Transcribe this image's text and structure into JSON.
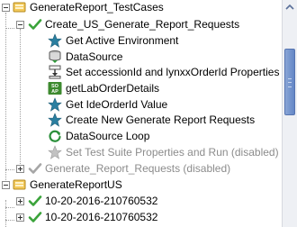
{
  "tree": {
    "suite": {
      "label": "GenerateReport_TestCases",
      "case_expanded": {
        "label": "Create_US_Generate_Report_Requests",
        "steps": [
          {
            "label": "Get Active Environment",
            "icon": "star-icon",
            "disabled": false
          },
          {
            "label": "DataSource",
            "icon": "datasource-icon",
            "disabled": false
          },
          {
            "label": "Set accessionId and lynxxOrderId Properties",
            "icon": "property-transfer-icon",
            "disabled": false
          },
          {
            "label": "getLabOrderDetails",
            "icon": "soap-request-icon",
            "disabled": false
          },
          {
            "label": "Get IdeOrderId Value",
            "icon": "star-icon",
            "disabled": false
          },
          {
            "label": "Create New Generate Report Requests",
            "icon": "star-icon",
            "disabled": false
          },
          {
            "label": "DataSource Loop",
            "icon": "loop-icon",
            "disabled": false
          },
          {
            "label": "Set Test Suite Properties and Run (disabled)",
            "icon": "star-icon",
            "disabled": true
          }
        ]
      },
      "case_collapsed": {
        "label": "Generate_Report_Requests (disabled)"
      }
    },
    "suite2": {
      "label": "GenerateReportUS",
      "cases": [
        {
          "label": "10-20-2016-210760532"
        },
        {
          "label": "10-20-2016-210760532"
        }
      ]
    }
  },
  "colors": {
    "suite_icon_gold": "#e8b33a",
    "check_green": "#3aa33a",
    "star_teal": "#2a7fa0",
    "disabled_text": "#8c8c8c",
    "scroll_thumb": "#6f8fcc"
  }
}
